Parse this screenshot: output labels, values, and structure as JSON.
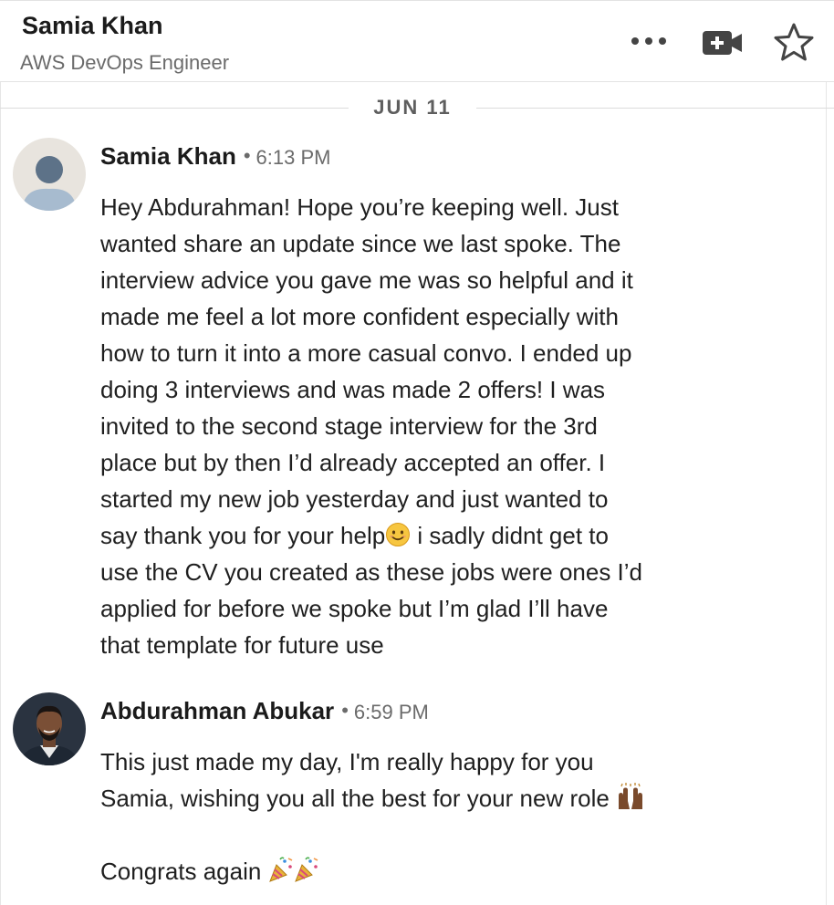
{
  "header": {
    "name": "Samia Khan",
    "subtitle": "AWS DevOps Engineer",
    "actions": [
      {
        "name": "more-options",
        "icon": "more-horizontal-icon"
      },
      {
        "name": "video-call",
        "icon": "video-plus-icon"
      },
      {
        "name": "star",
        "icon": "star-outline-icon"
      }
    ]
  },
  "date_divider": "JUN 11",
  "messages": [
    {
      "sender": "Samia Khan",
      "separator": "•",
      "time": "6:13 PM",
      "avatar": "default-avatar-icon",
      "lines": [
        "Hey Abdurahman! Hope you’re keeping well. Just",
        "wanted share an update since we last spoke. The",
        "interview advice you gave me was so helpful and it",
        "made me feel a lot more confident especially with",
        "how to turn it into a more casual convo. I ended up",
        "doing 3 interviews and was made 2 offers! I was",
        "invited to the second stage interview for the 3rd",
        "place but by then I’d already accepted an offer. I",
        "started my new job yesterday and just wanted to",
        "say thank you for your help",
        " i sadly didnt get to",
        "use the CV you created as these jobs were ones I’d",
        "applied for before we spoke but I’m glad I’ll have",
        "that template for future use"
      ]
    },
    {
      "sender": "Abdurahman Abukar",
      "separator": "•",
      "time": "6:59 PM",
      "avatar": "profile-photo-avatar",
      "lines": [
        "This just made my day, I'm really happy for you",
        "Samia, wishing you all the best for your new role",
        "",
        "Congrats again"
      ]
    }
  ],
  "emojis": {
    "smile": "smiling-face-icon",
    "raised_hands": "raised-hands-icon",
    "party": "party-popper-icon"
  },
  "colors": {
    "text": "#1f1f1f",
    "muted": "#6b6b6b",
    "border": "#e3e3e3"
  }
}
